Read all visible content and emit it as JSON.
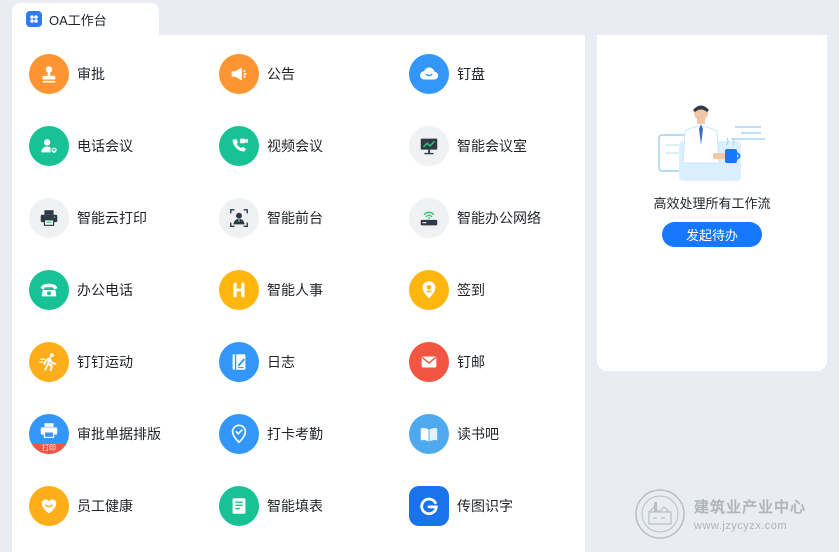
{
  "tab": {
    "label": "OA工作台"
  },
  "apps": [
    {
      "label": "审批",
      "icon": "stamp-icon",
      "color": "#ff9532"
    },
    {
      "label": "公告",
      "icon": "megaphone-icon",
      "color": "#ff9532"
    },
    {
      "label": "钉盘",
      "icon": "cloud-icon",
      "color": "#3296fa"
    },
    {
      "label": "电话会议",
      "icon": "phone-user-icon",
      "color": "#17c295"
    },
    {
      "label": "视频会议",
      "icon": "video-call-icon",
      "color": "#17c295"
    },
    {
      "label": "智能会议室",
      "icon": "presentation-screen-icon",
      "color": "#f0f1f3"
    },
    {
      "label": "智能云打印",
      "icon": "printer-icon",
      "color": "#f0f1f3"
    },
    {
      "label": "智能前台",
      "icon": "face-scan-icon",
      "color": "#f0f1f3"
    },
    {
      "label": "智能办公网络",
      "icon": "wifi-router-icon",
      "color": "#f0f1f3"
    },
    {
      "label": "办公电话",
      "icon": "telephone-icon",
      "color": "#17c295"
    },
    {
      "label": "智能人事",
      "icon": "h-letter-icon",
      "color": "#ffb60f"
    },
    {
      "label": "签到",
      "icon": "location-pin-icon",
      "color": "#ffb60f"
    },
    {
      "label": "钉钉运动",
      "icon": "running-icon",
      "color": "#ffae1a"
    },
    {
      "label": "日志",
      "icon": "notebook-pen-icon",
      "color": "#3296fa"
    },
    {
      "label": "钉邮",
      "icon": "mail-icon",
      "color": "#f25643"
    },
    {
      "label": "审批单据排版",
      "icon": "document-printer-icon",
      "color": "#3296fa"
    },
    {
      "label": "打卡考勤",
      "icon": "checkin-pin-icon",
      "color": "#3296fa"
    },
    {
      "label": "读书吧",
      "icon": "open-book-icon",
      "color": "#4fa9ef"
    },
    {
      "label": "员工健康",
      "icon": "heart-smile-icon",
      "color": "#ffae1a"
    },
    {
      "label": "智能填表",
      "icon": "form-icon",
      "color": "#17c295"
    },
    {
      "label": "传图识字",
      "icon": "g-logo-icon",
      "color": "#1a73e8"
    }
  ],
  "badge_text": "打印",
  "panel": {
    "title": "高效处理所有工作流",
    "button_label": "发起待办"
  },
  "watermark": {
    "title": "建筑业产业中心",
    "url": "www.jzycyzx.com"
  }
}
